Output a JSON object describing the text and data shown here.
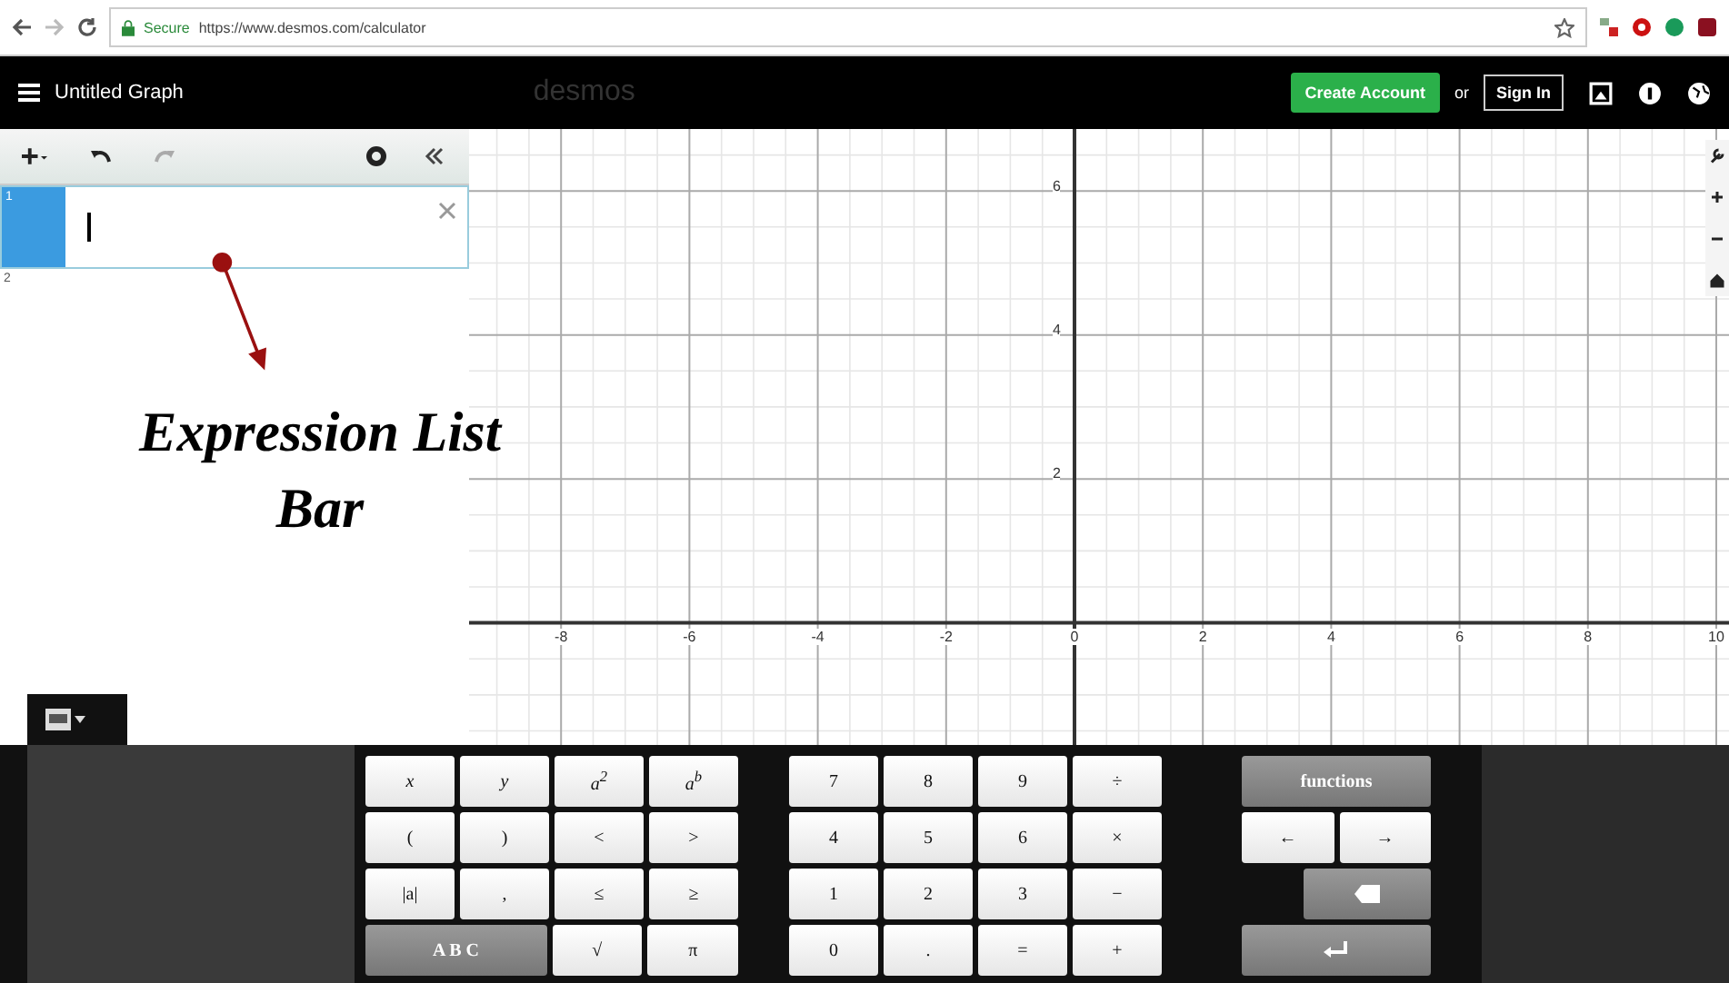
{
  "browser": {
    "secure_label": "Secure",
    "url": "https://www.desmos.com/calculator"
  },
  "header": {
    "title": "Untitled Graph",
    "logo": "desmos",
    "create_account": "Create Account",
    "or": "or",
    "sign_in": "Sign In"
  },
  "expressions": [
    {
      "index": "1",
      "selected": true
    },
    {
      "index": "2",
      "selected": false
    }
  ],
  "annotation": "Expression List Bar",
  "graph": {
    "x_ticks": [
      "-8",
      "-6",
      "-4",
      "-2",
      "0",
      "2",
      "4",
      "6",
      "8",
      "10"
    ],
    "y_ticks": [
      "6",
      "4",
      "2"
    ]
  },
  "keypad": {
    "groups": [
      {
        "rows": [
          [
            {
              "label": "x",
              "kind": "letter"
            },
            {
              "label": "y",
              "kind": "letter"
            },
            {
              "label": "a$^{2}$",
              "kind": "letter"
            },
            {
              "label": "a$^{b}$",
              "kind": "letter"
            }
          ],
          [
            {
              "label": "(",
              "kind": "plain"
            },
            {
              "label": ")",
              "kind": "plain"
            },
            {
              "label": "<",
              "kind": "plain"
            },
            {
              "label": ">",
              "kind": "plain"
            }
          ],
          [
            {
              "label": "|a|",
              "kind": "plain"
            },
            {
              "label": ",",
              "kind": "plain"
            },
            {
              "label": "≤",
              "kind": "plain"
            },
            {
              "label": "≥",
              "kind": "plain"
            }
          ],
          [
            {
              "label": "A B C",
              "kind": "action-wide",
              "colspan": 2
            },
            {
              "label": "√",
              "kind": "plain"
            },
            {
              "label": "π",
              "kind": "plain"
            }
          ]
        ]
      },
      {
        "rows": [
          [
            {
              "label": "7",
              "kind": "plain"
            },
            {
              "label": "8",
              "kind": "plain"
            },
            {
              "label": "9",
              "kind": "plain"
            },
            {
              "label": "÷",
              "kind": "plain"
            }
          ],
          [
            {
              "label": "4",
              "kind": "plain"
            },
            {
              "label": "5",
              "kind": "plain"
            },
            {
              "label": "6",
              "kind": "plain"
            },
            {
              "label": "×",
              "kind": "plain"
            }
          ],
          [
            {
              "label": "1",
              "kind": "plain"
            },
            {
              "label": "2",
              "kind": "plain"
            },
            {
              "label": "3",
              "kind": "plain"
            },
            {
              "label": "−",
              "kind": "plain"
            }
          ],
          [
            {
              "label": "0",
              "kind": "plain"
            },
            {
              "label": ".",
              "kind": "plain"
            },
            {
              "label": "=",
              "kind": "plain"
            },
            {
              "label": "+",
              "kind": "plain"
            }
          ]
        ]
      },
      {
        "rows": [
          [
            {
              "label": "functions",
              "kind": "action-wide",
              "colspan": 2
            }
          ],
          [
            {
              "label": "←",
              "kind": "plain"
            },
            {
              "label": "→",
              "kind": "plain"
            }
          ],
          [
            {
              "kind": "backspace"
            }
          ],
          [
            {
              "kind": "enter",
              "colspan": 2
            }
          ]
        ]
      }
    ]
  }
}
